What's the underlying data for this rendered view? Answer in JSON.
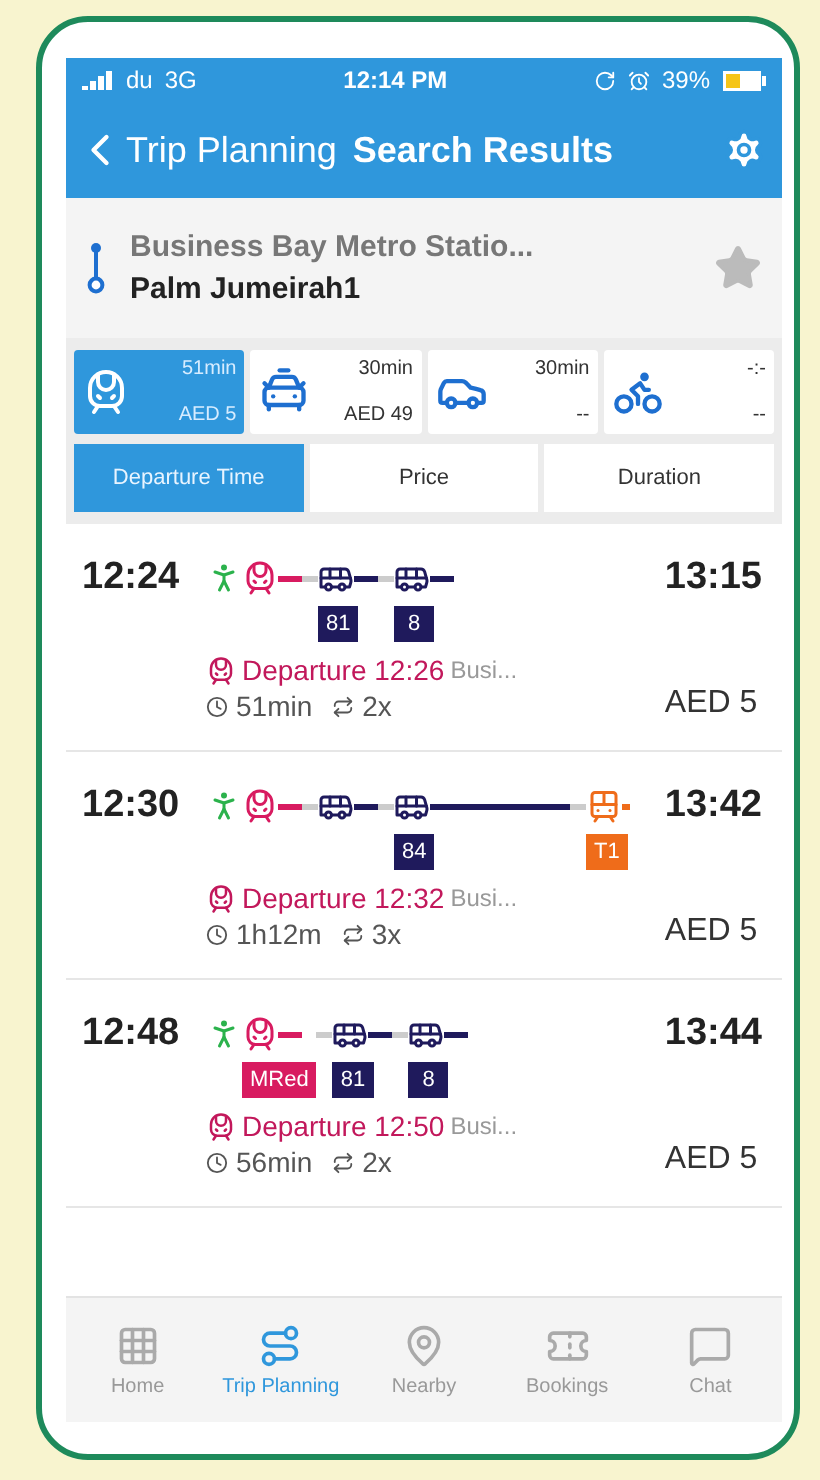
{
  "status_bar": {
    "carrier": "du",
    "network": "3G",
    "time": "12:14 PM",
    "battery": "39%"
  },
  "header": {
    "back": "Trip Planning",
    "title": "Search Results"
  },
  "route": {
    "from": "Business Bay Metro Statio...",
    "to": "Palm Jumeirah1",
    "starred": false
  },
  "modes": [
    {
      "kind": "transit",
      "duration": "51min",
      "price": "AED 5",
      "selected": true
    },
    {
      "kind": "taxi",
      "duration": "30min",
      "price": "AED 49",
      "selected": false
    },
    {
      "kind": "car",
      "duration": "30min",
      "price": "--",
      "selected": false
    },
    {
      "kind": "bike",
      "duration": "-:-",
      "price": "--",
      "selected": false
    }
  ],
  "sort_tabs": [
    {
      "label": "Departure Time",
      "selected": true
    },
    {
      "label": "Price",
      "selected": false
    },
    {
      "label": "Duration",
      "selected": false
    }
  ],
  "trips": [
    {
      "depart": "12:24",
      "arrive": "13:15",
      "legs": [
        {
          "kind": "walk"
        },
        {
          "kind": "metro",
          "color": "#d81b60"
        },
        {
          "kind": "bus",
          "color": "#1f1a5c",
          "line": "81"
        },
        {
          "kind": "bus",
          "color": "#1f1a5c",
          "line": "8"
        }
      ],
      "departure": "Departure 12:26",
      "station": "Busi...",
      "duration": "51min",
      "transfers": "2x",
      "price": "AED 5"
    },
    {
      "depart": "12:30",
      "arrive": "13:42",
      "legs": [
        {
          "kind": "walk"
        },
        {
          "kind": "metro",
          "color": "#d81b60"
        },
        {
          "kind": "bus",
          "color": "#1f1a5c"
        },
        {
          "kind": "bus",
          "color": "#1f1a5c",
          "line": "84",
          "long": true
        },
        {
          "kind": "tram",
          "color": "#ef6c1a",
          "line": "T1"
        }
      ],
      "departure": "Departure 12:32",
      "station": "Busi...",
      "duration": "1h12m",
      "transfers": "3x",
      "price": "AED 5"
    },
    {
      "depart": "12:48",
      "arrive": "13:44",
      "legs": [
        {
          "kind": "walk"
        },
        {
          "kind": "metro",
          "color": "#d81b60",
          "line": "MRed"
        },
        {
          "kind": "bus",
          "color": "#1f1a5c",
          "line": "81"
        },
        {
          "kind": "bus",
          "color": "#1f1a5c",
          "line": "8"
        }
      ],
      "departure": "Departure 12:50",
      "station": "Busi...",
      "duration": "56min",
      "transfers": "2x",
      "price": "AED 5"
    }
  ],
  "tab_bar": [
    {
      "kind": "home",
      "label": "Home",
      "selected": false
    },
    {
      "kind": "trip",
      "label": "Trip Planning",
      "selected": true
    },
    {
      "kind": "nearby",
      "label": "Nearby",
      "selected": false
    },
    {
      "kind": "bookings",
      "label": "Bookings",
      "selected": false
    },
    {
      "kind": "chat",
      "label": "Chat",
      "selected": false
    }
  ]
}
